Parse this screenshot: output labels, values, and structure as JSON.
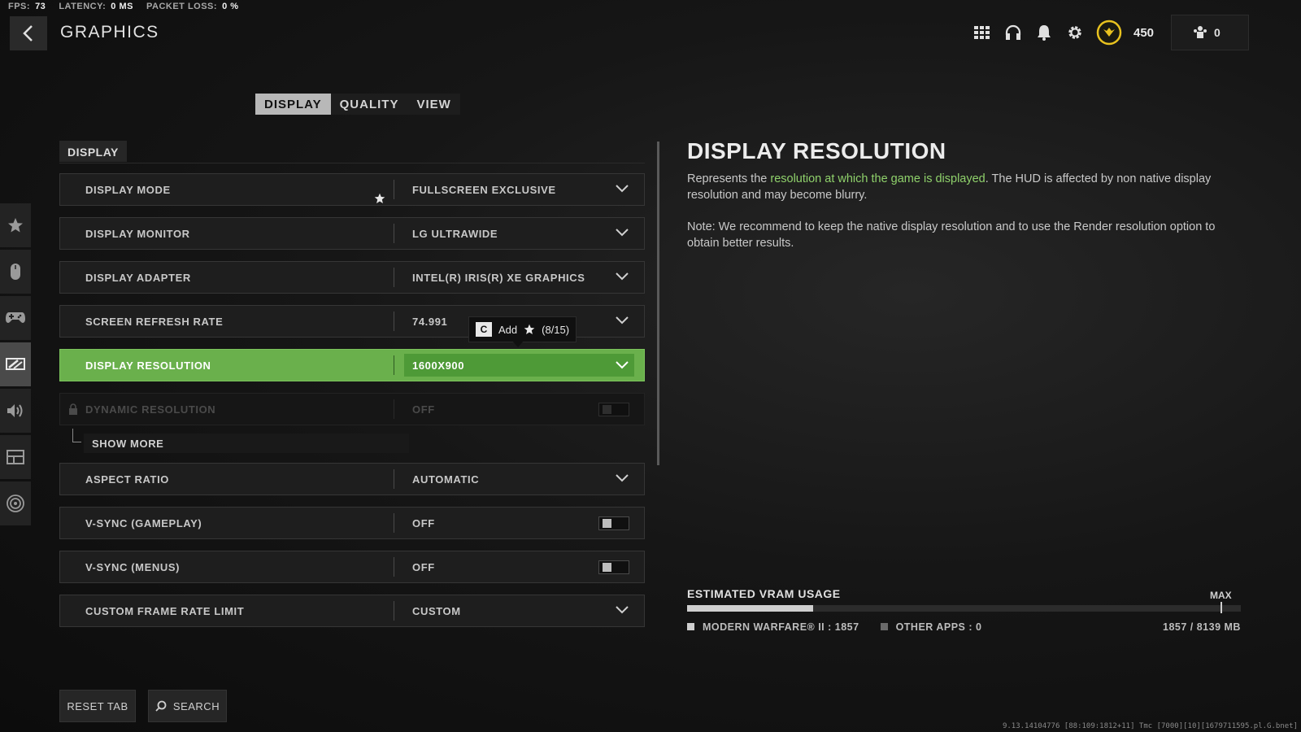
{
  "stats": {
    "fps_label": "FPS:",
    "fps_value": "73",
    "latency_label": "LATENCY:",
    "latency_value": "0 MS",
    "packet_loss_label": "PACKET LOSS:",
    "packet_loss_value": "0 %"
  },
  "header": {
    "title": "GRAPHICS",
    "currency": "450",
    "party_count": "0"
  },
  "tabs": [
    "DISPLAY",
    "QUALITY",
    "VIEW"
  ],
  "active_tab": 0,
  "section_label": "DISPLAY",
  "settings": [
    {
      "label": "DISPLAY MODE",
      "value": "FULLSCREEN EXCLUSIVE",
      "control": "dropdown"
    },
    {
      "label": "DISPLAY MONITOR",
      "value": "LG ULTRAWIDE",
      "control": "dropdown"
    },
    {
      "label": "DISPLAY ADAPTER",
      "value": "INTEL(R) IRIS(R) XE GRAPHICS",
      "control": "dropdown"
    },
    {
      "label": "SCREEN REFRESH RATE",
      "value": "74.991",
      "control": "dropdown"
    },
    {
      "label": "DISPLAY RESOLUTION",
      "value": "1600X900",
      "control": "dropdown",
      "selected": true
    },
    {
      "label": "DYNAMIC RESOLUTION",
      "value": "OFF",
      "control": "toggle",
      "disabled": true
    },
    {
      "label": "ASPECT RATIO",
      "value": "AUTOMATIC",
      "control": "dropdown"
    },
    {
      "label": "V-SYNC (GAMEPLAY)",
      "value": "OFF",
      "control": "toggle"
    },
    {
      "label": "V-SYNC (MENUS)",
      "value": "OFF",
      "control": "toggle"
    },
    {
      "label": "CUSTOM FRAME RATE LIMIT",
      "value": "CUSTOM",
      "control": "dropdown"
    }
  ],
  "show_more": "SHOW MORE",
  "tooltip": {
    "key": "C",
    "text": "Add",
    "count": "(8/15)"
  },
  "detail": {
    "title": "DISPLAY RESOLUTION",
    "p1_a": "Represents the ",
    "p1_highlight": "resolution at which the game is displayed",
    "p1_b": ". The HUD is affected by non native display resolution and may become blurry.",
    "p2": "Note: We recommend to keep the native display resolution and to use the Render resolution option to obtain better results."
  },
  "vram": {
    "title": "ESTIMATED VRAM USAGE",
    "max_label": "MAX",
    "used_mb": 1857,
    "total_mb": 8139,
    "legend_game": "MODERN WARFARE® II : 1857",
    "legend_other": "OTHER APPS : 0",
    "total_text": "1857 / 8139 MB",
    "game_color": "#cfcfcf",
    "other_color": "#6a6a6a"
  },
  "buttons": {
    "reset": "RESET TAB",
    "search": "SEARCH"
  },
  "build_info": "9.13.14104776 [88:109:1812+11] Tmc [7000][10][1679711595.pl.G.bnet]",
  "colors": {
    "accent_green": "#6ab04c",
    "highlight_text": "#8fd16b"
  },
  "sidebar_icons": [
    "star-icon",
    "mouse-icon",
    "controller-icon",
    "graphics-icon",
    "speaker-icon",
    "interface-icon",
    "network-icon"
  ]
}
